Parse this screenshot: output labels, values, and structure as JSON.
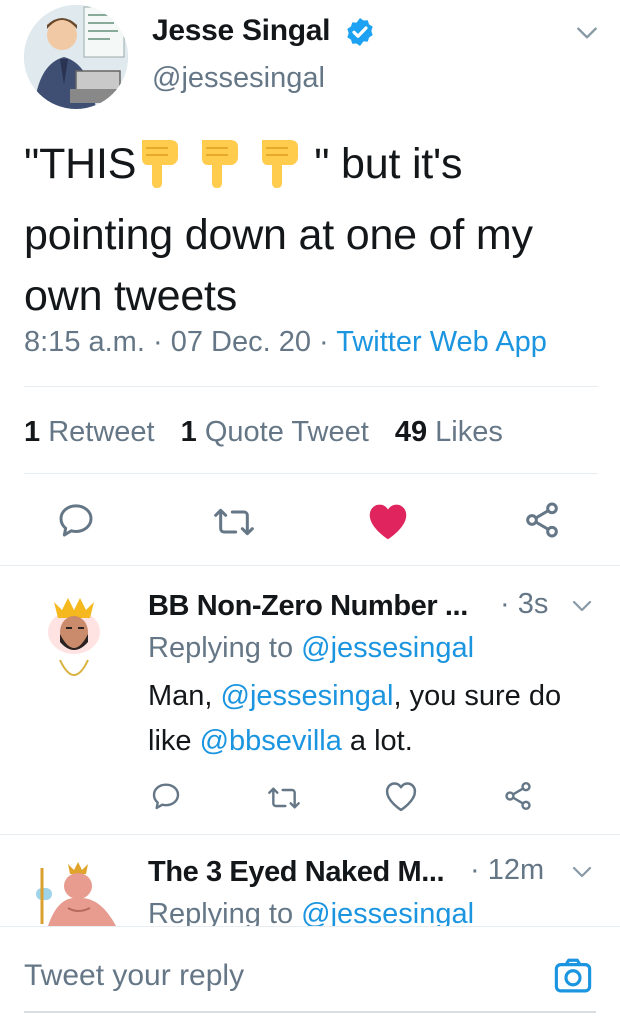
{
  "tweet": {
    "author_name": "Jesse Singal",
    "author_handle": "@jessesingal",
    "text_line1_before": "\"THIS",
    "text_line1_after": "\" but it's",
    "text_line2": "pointing down at one of my",
    "text_line3": "own tweets",
    "time": "8:15 a.m.",
    "sep1": "·",
    "date": "07 Dec. 20",
    "sep2": "·",
    "source": "Twitter Web App",
    "stats": {
      "retweets_count": "1",
      "retweets_label": "Retweet",
      "quotes_count": "1",
      "quotes_label": "Quote Tweet",
      "likes_count": "49",
      "likes_label": "Likes"
    },
    "liked": true
  },
  "replies": [
    {
      "name": "BB Non-Zero Number ...",
      "sep": "·",
      "time": "3s",
      "replying_prefix": "Replying to",
      "replying_handle": "@jessesingal",
      "text_1": "Man, ",
      "mention_1": "@jessesingal",
      "text_2": ", you sure do",
      "text_3": "like ",
      "mention_2": "@bbsevilla",
      "text_4": " a lot."
    },
    {
      "name": "The 3 Eyed Naked M...",
      "sep": "·",
      "time": "12m",
      "replying_prefix": "Replying to",
      "replying_handle": "@jessesingal"
    }
  ],
  "composer": {
    "placeholder": "Tweet your reply"
  },
  "colors": {
    "accent": "#1b95e0",
    "like": "#e0245e",
    "muted": "#657786",
    "text": "#14171a",
    "verified": "#1da1f2"
  },
  "icons": [
    "chevron-down-icon",
    "verified-badge-icon",
    "point-down-emoji",
    "reply-icon",
    "retweet-icon",
    "heart-icon",
    "share-icon",
    "camera-icon"
  ]
}
